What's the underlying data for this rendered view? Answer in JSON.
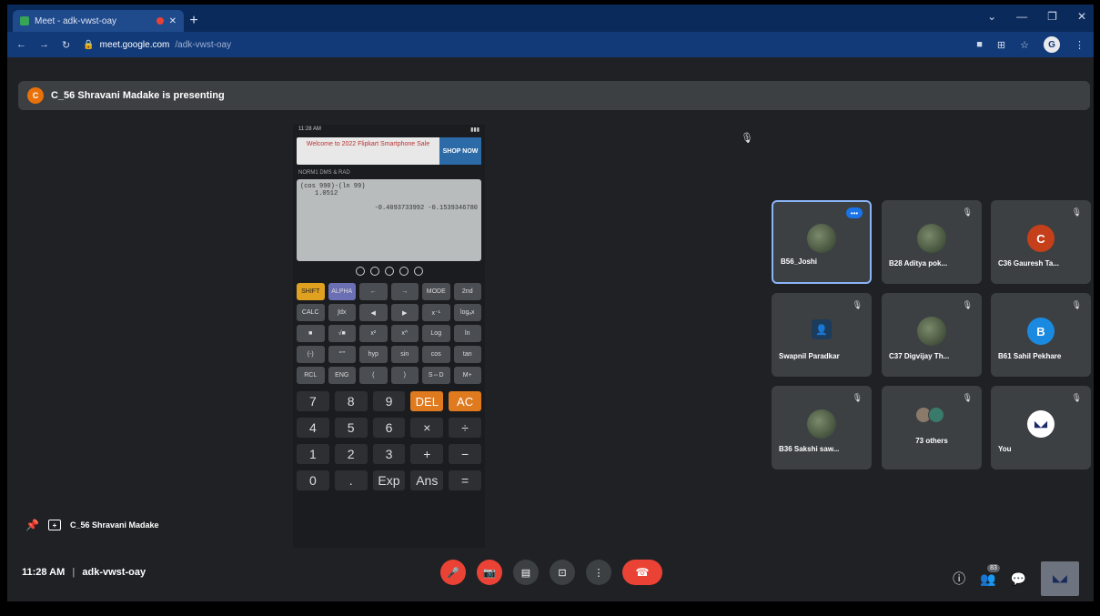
{
  "browser": {
    "tab_title": "Meet - adk-vwst-oay",
    "tab_close": "✕",
    "new_tab": "+",
    "url_domain": "meet.google.com",
    "url_path": "/adk-vwst-oay",
    "window_controls": [
      "⌄",
      "—",
      "❐",
      "✕"
    ],
    "profile_initial": "G"
  },
  "banner": {
    "avatar_letter": "C",
    "text": "C_56 Shravani Madake is presenting"
  },
  "phone": {
    "status_time": "11:28 AM",
    "ad_text": "Welcome to 2022 Flipkart Smartphone Sale",
    "ad_button": "SHOP NOW",
    "mode_line": "NORM1 DMS & RAD",
    "lcd_input": "(cos 990)-(ln 99)",
    "lcd_input2": "1.0512",
    "lcd_result": "-0.4093733992 -0.1539346780",
    "fn_keys": [
      "SHIFT",
      "ALPHA",
      "←",
      "→",
      "MODE",
      "2nd",
      "CALC",
      "∫dx",
      "◀",
      "▶",
      "x⁻¹",
      "logₐx",
      "■",
      "√■",
      "x²",
      "x^",
      "Log",
      "ln",
      "(-)",
      "°'''",
      "hyp",
      "sin",
      "cos",
      "tan",
      "RCL",
      "ENG",
      "(",
      ")",
      "S⇔D",
      "M+"
    ],
    "num_keys": [
      "7",
      "8",
      "9",
      "DEL",
      "AC",
      "4",
      "5",
      "6",
      "×",
      "÷",
      "1",
      "2",
      "3",
      "+",
      "−",
      "0",
      ".",
      "Exp",
      "Ans",
      "="
    ]
  },
  "participants": [
    {
      "name": "B56_Joshi",
      "type": "photo",
      "more": "•••"
    },
    {
      "name": "B28 Aditya pok...",
      "type": "photo"
    },
    {
      "name": "C36 Gauresh Ta...",
      "type": "letter",
      "letter": "C",
      "color": "#c5401a"
    },
    {
      "name": "Swapnil Paradkar",
      "type": "square"
    },
    {
      "name": "C37 Digvijay Th...",
      "type": "photo"
    },
    {
      "name": "B61 Sahil Pekhare",
      "type": "letter",
      "letter": "B",
      "color": "#1a8ae0"
    },
    {
      "name": "B36 Sakshi saw...",
      "type": "photo"
    },
    {
      "name": "73 others",
      "type": "others"
    },
    {
      "name": "You",
      "type": "logo"
    }
  ],
  "pinned": {
    "name": "C_56 Shravani Madake"
  },
  "meeting": {
    "time": "11:28 AM",
    "separator": "|",
    "code": "adk-vwst-oay"
  },
  "controls": {
    "mic": "🎤",
    "camera": "📷",
    "captions": "▤",
    "present": "⊡",
    "more": "⋮",
    "end": "☎"
  },
  "right_controls": {
    "info": "ⓘ",
    "people_count": "83",
    "chat": "💬"
  }
}
